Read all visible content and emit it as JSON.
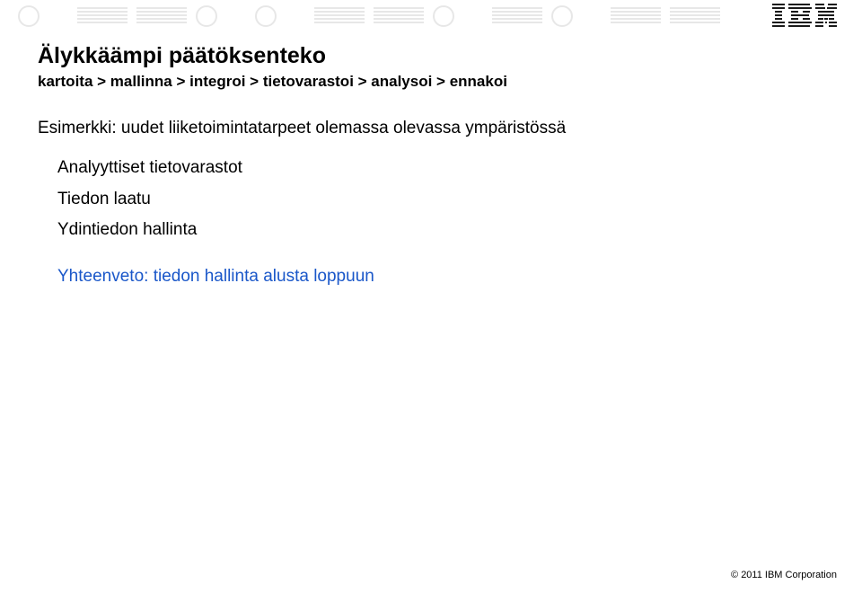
{
  "header": {
    "logo_alt": "IBM"
  },
  "title": "Älykkäämpi päätöksenteko",
  "subtitle": "kartoita > mallinna > integroi > tietovarastoi > analysoi > ennakoi",
  "body": {
    "line1": "Esimerkki: uudet liiketoimintatarpeet olemassa olevassa ympäristössä",
    "sub1": "Analyyttiset tietovarastot",
    "sub2": "Tiedon laatu",
    "sub3": "Ydintiedon hallinta",
    "highlight": "Yhteenveto: tiedon hallinta alusta loppuun"
  },
  "footer": "© 2011 IBM Corporation"
}
